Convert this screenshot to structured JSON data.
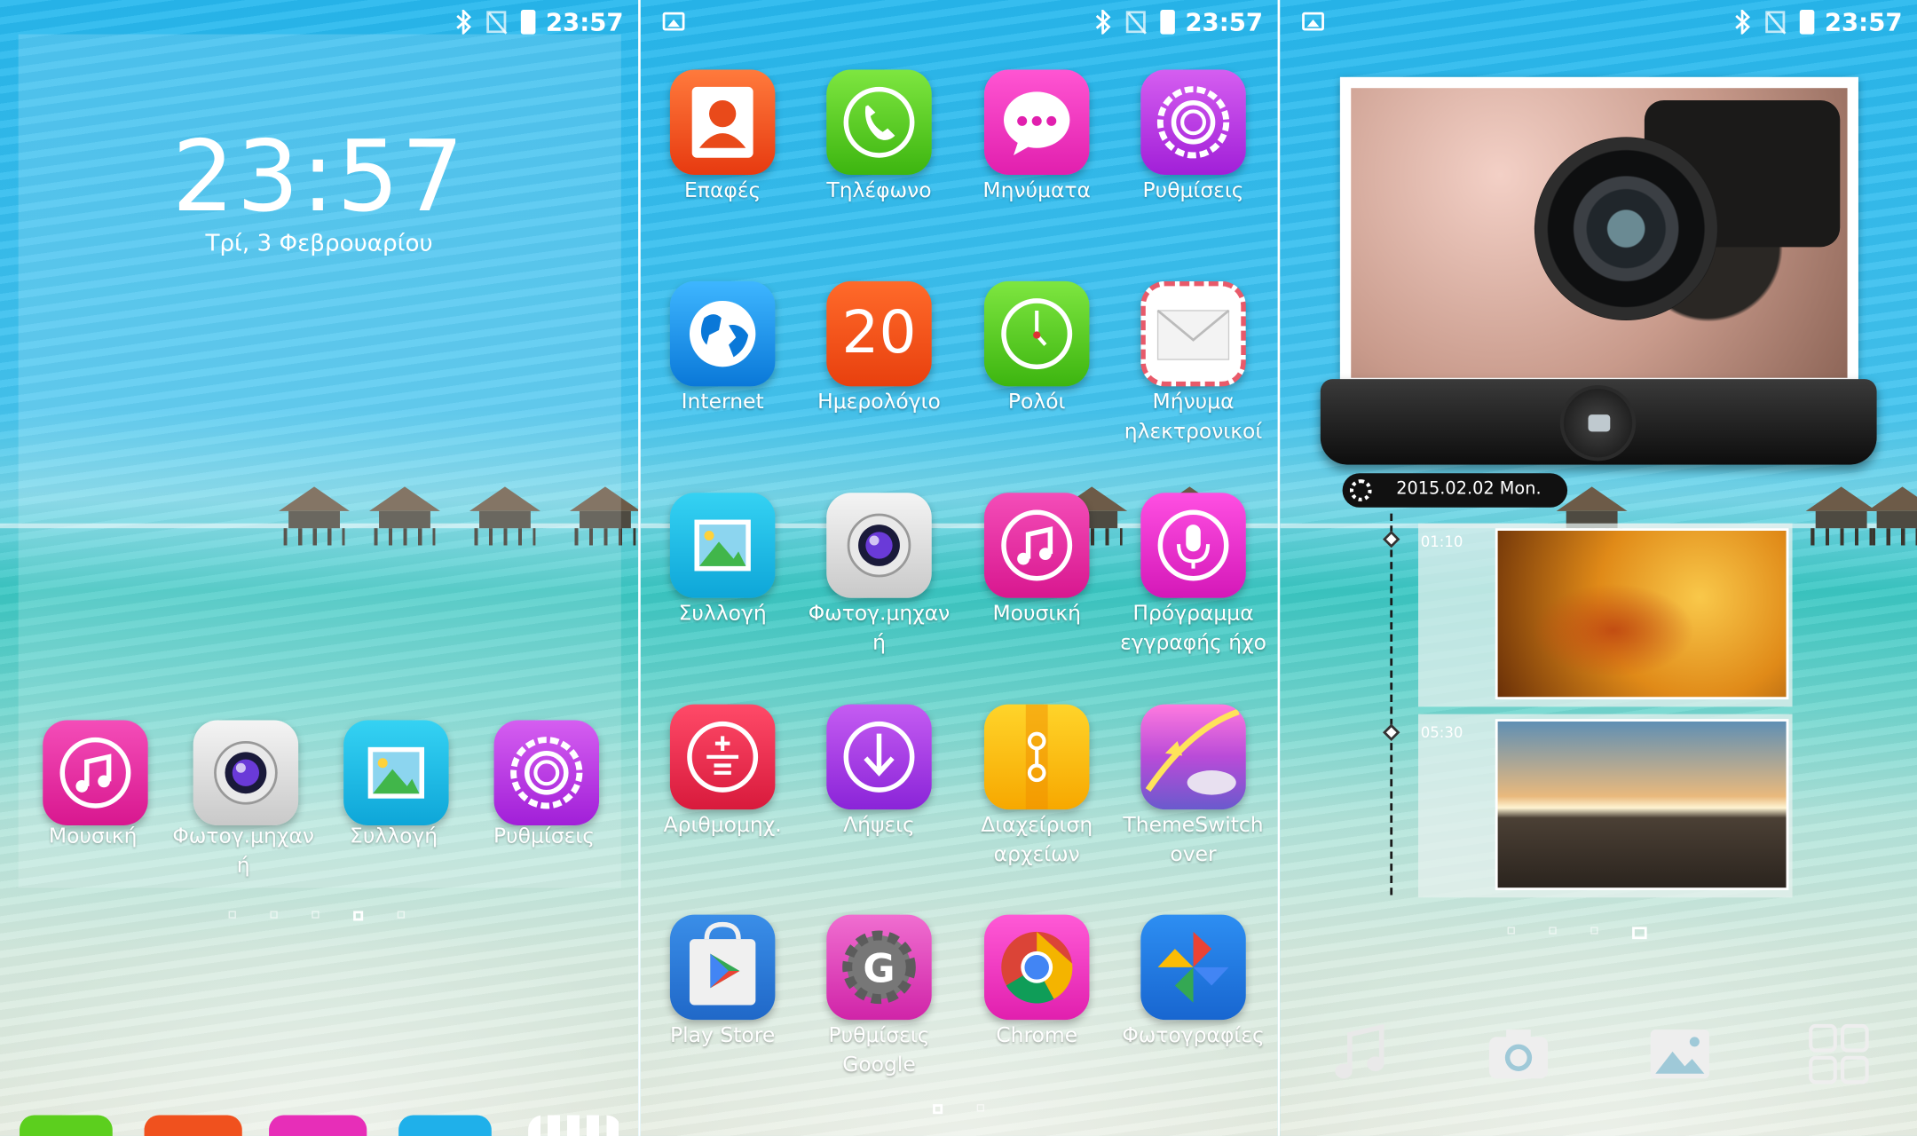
{
  "status": {
    "time": "23:57"
  },
  "lock": {
    "clock": "23:57",
    "date": "Τρί, 3 Φεβρουαρίου",
    "dock": [
      {
        "label": "Μουσική",
        "icon": "music-icon"
      },
      {
        "label": "Φωτογ.μηχαν ή",
        "icon": "camera-icon"
      },
      {
        "label": "Συλλογή",
        "icon": "gallery-icon"
      },
      {
        "label": "Ρυθμίσεις",
        "icon": "settings-icon"
      }
    ]
  },
  "apps": [
    {
      "label": "Επαφές",
      "icon": "contacts-icon"
    },
    {
      "label": "Τηλέφωνο",
      "icon": "phone-icon"
    },
    {
      "label": "Μηνύματα",
      "icon": "messages-icon"
    },
    {
      "label": "Ρυθμίσεις",
      "icon": "settings-icon"
    },
    {
      "label": "Internet",
      "icon": "globe-icon"
    },
    {
      "label": "Ημερολόγιο",
      "icon": "calendar-icon",
      "badge": "20"
    },
    {
      "label": "Ρολόι",
      "icon": "clock-icon"
    },
    {
      "label": "Μήνυμα ηλεκτρονικοί",
      "icon": "email-icon"
    },
    {
      "label": "Συλλογή",
      "icon": "gallery-icon"
    },
    {
      "label": "Φωτογ.μηχαν ή",
      "icon": "camera-icon"
    },
    {
      "label": "Μουσική",
      "icon": "music-icon"
    },
    {
      "label": "Πρόγραμμα εγγραφής ήχο",
      "icon": "voice-recorder-icon"
    },
    {
      "label": "Αριθμομηχ.",
      "icon": "calculator-icon"
    },
    {
      "label": "Λήψεις",
      "icon": "downloads-icon"
    },
    {
      "label": "Διαχείριση αρχείων",
      "icon": "file-manager-icon"
    },
    {
      "label": "ThemeSwitch over",
      "icon": "theme-switchover-icon"
    },
    {
      "label": "Play Store",
      "icon": "play-store-icon"
    },
    {
      "label": "Ρυθμίσεις Google",
      "icon": "google-settings-icon"
    },
    {
      "label": "Chrome",
      "icon": "chrome-icon"
    },
    {
      "label": "Φωτογραφίες",
      "icon": "photos-icon"
    }
  ],
  "widget": {
    "date": "2015.02.02 Mon.",
    "entries": [
      {
        "time": "01:10"
      },
      {
        "time": "05:30"
      }
    ]
  },
  "colors": {
    "sky": "#27b8ee",
    "orange": "#f0511e",
    "green": "#5ccf1e",
    "magenta": "#e72eb8",
    "purple": "#c233e8",
    "blue": "#1a8ee8",
    "cyan": "#22c4ea",
    "red": "#e2294a",
    "yellow": "#ffc209"
  }
}
